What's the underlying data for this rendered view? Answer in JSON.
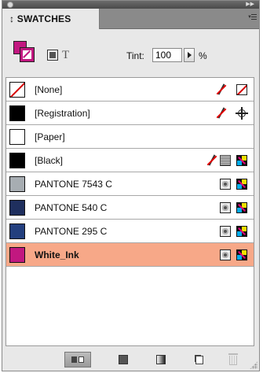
{
  "panel": {
    "tab_label": "SWATCHES",
    "tab_arrow": "↕"
  },
  "toolbar": {
    "format_text_glyph": "T",
    "tint_label": "Tint:",
    "tint_value": "100",
    "tint_unit": "%"
  },
  "swatches": [
    {
      "name": "[None]",
      "chip": "none",
      "color": "#ffffff",
      "editable": false,
      "type_icon": "none-icon"
    },
    {
      "name": "[Registration]",
      "chip": "solid",
      "color": "#000000",
      "editable": false,
      "type_icon": "registration-icon"
    },
    {
      "name": "[Paper]",
      "chip": "solid",
      "color": "#ffffff",
      "editable": true,
      "type_icon": ""
    },
    {
      "name": "[Black]",
      "chip": "solid",
      "color": "#000000",
      "editable": false,
      "type_icon": "process-cmyk-icon"
    },
    {
      "name": "PANTONE 7543 C",
      "chip": "solid",
      "color": "#a7adb2",
      "editable": true,
      "type_icon": "spot-cmyk-icon"
    },
    {
      "name": "PANTONE 540 C",
      "chip": "solid",
      "color": "#1f2f5e",
      "editable": true,
      "type_icon": "spot-cmyk-icon"
    },
    {
      "name": "PANTONE 295 C",
      "chip": "solid",
      "color": "#233f7e",
      "editable": true,
      "type_icon": "spot-cmyk-icon"
    },
    {
      "name": "White_Ink",
      "chip": "solid",
      "color": "#c21880",
      "editable": true,
      "type_icon": "spot-cmyk-icon",
      "selected": true
    }
  ],
  "colors": {
    "fill": "#c21880",
    "selected_row": "#f7a888",
    "panel_bg": "#e8e8e8"
  },
  "bottom_bar": {
    "buttons": [
      "show-all-swatches",
      "show-color-swatches",
      "show-gradient-swatches",
      "new-swatch",
      "delete-swatch"
    ]
  }
}
